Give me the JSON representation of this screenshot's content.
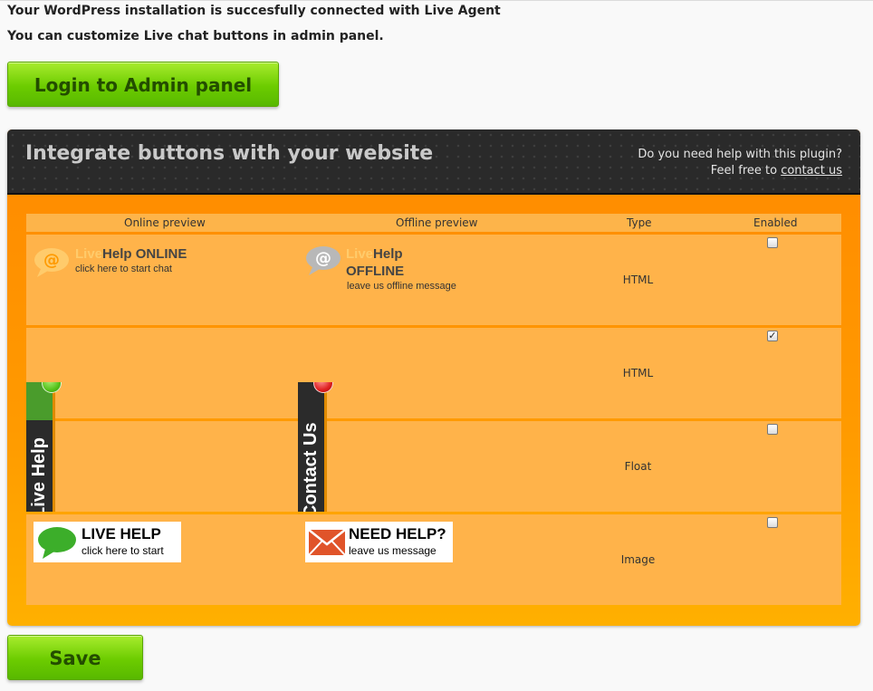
{
  "status": {
    "line1": "Your WordPress installation is succesfully connected with Live Agent",
    "line2": "You can customize Live chat buttons in admin panel."
  },
  "login_button": "Login to Admin panel",
  "save_button": "Save",
  "panel": {
    "title": "Integrate buttons with your website",
    "help_line1": "Do you need help with this plugin?",
    "help_line2_prefix": "Feel free to",
    "help_link": "contact us"
  },
  "table": {
    "headers": [
      "Online preview",
      "Offline preview",
      "Type",
      "Enabled"
    ],
    "rows": [
      {
        "online": {
          "live": "Live",
          "help": "Help ONLINE",
          "sub": "click here to start chat"
        },
        "offline": {
          "live": "Live",
          "help": "Help",
          "status": "OFFLINE",
          "sub": "leave us offline message"
        },
        "type": "HTML",
        "enabled": false
      },
      {
        "online": {
          "tab_text": "Live Help",
          "dot_color": "#55c21a"
        },
        "offline": {
          "tab_text": "Contact Us",
          "dot_color": "#e02020"
        },
        "type": "HTML",
        "enabled": true
      },
      {
        "type": "Float",
        "enabled": false
      },
      {
        "online": {
          "title": "LIVE HELP",
          "sub": "click here to start"
        },
        "offline": {
          "title": "NEED HELP?",
          "sub": "leave us message"
        },
        "type": "Image",
        "enabled": false
      }
    ]
  },
  "colors": {
    "accent_green": "#6ccc00",
    "panel_orange": "#ff9a00",
    "header_dark": "#2a2a2a"
  }
}
